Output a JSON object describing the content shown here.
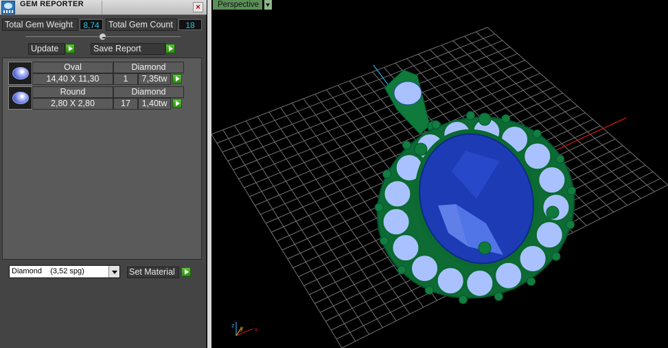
{
  "window": {
    "title": "GEM REPORTER",
    "close_glyph": "×"
  },
  "stats": {
    "total_weight_label": "Total Gem Weight",
    "total_weight_value": "8,74",
    "total_count_label": "Total Gem Count",
    "total_count_value": "18"
  },
  "toolbar": {
    "update_label": "Update",
    "save_label": "Save Report"
  },
  "gems": [
    {
      "shape": "Oval",
      "material": "Diamond",
      "size": "14,40 X 11,30",
      "count": "1",
      "weight": "7,35tw"
    },
    {
      "shape": "Round",
      "material": "Diamond",
      "size": "2,80 X 2,80",
      "count": "17",
      "weight": "1,40tw"
    }
  ],
  "material": {
    "selected": "Diamond    (3,52 spg)",
    "set_label": "Set Material"
  },
  "viewport": {
    "view_name": "Perspective",
    "axis_x": "x",
    "axis_y": "y",
    "axis_z": "z"
  },
  "colors": {
    "accent_value": "#27c4e6",
    "go_green": "#3a9e1e",
    "metal": "#0f7a3a",
    "center_stone": "#1d3bb5",
    "side_stone": "#a9c2ff"
  }
}
